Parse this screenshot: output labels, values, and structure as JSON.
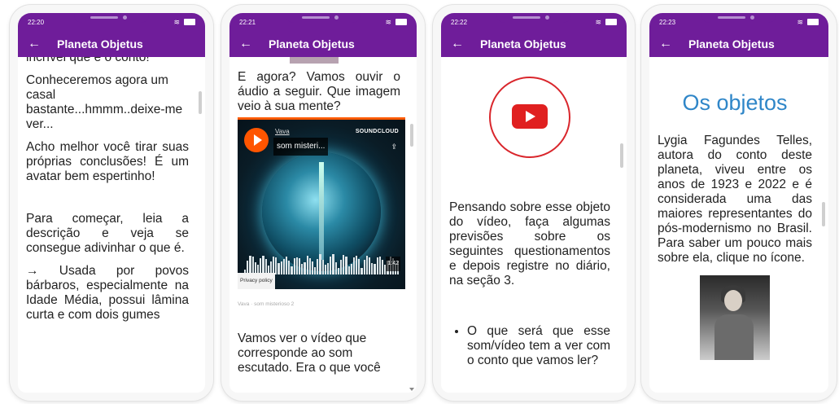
{
  "colors": {
    "appbar": "#6f1d9a",
    "youtube": "#e02020",
    "title_blue": "#2f86c8"
  },
  "icons": {
    "back": "←",
    "wifi": "wifi-icon",
    "battery": "battery-icon"
  },
  "app": {
    "title": "Planeta Objetus",
    "back_glyph": "←",
    "wifi_glyph": "≋"
  },
  "phones": [
    {
      "time": "22:20",
      "paragraphs": [
        "incrível que é o conto!",
        "Conheceremos agora um casal bastante...hmmm..deixe-me ver...",
        "Acho melhor você tirar suas próprias conclusões! É um avatar bem espertinho!",
        "Para começar, leia a descrição e veja se consegue adivinhar o que é.",
        "→ Usada por povos bárbaros, especialmente na Idade Média, possui lâmina curta e com dois gumes"
      ]
    },
    {
      "time": "22:21",
      "intro": "E agora? Vamos ouvir o áudio a seguir. Que imagem veio à sua mente?",
      "player": {
        "user": "Vava",
        "track": "som misteri...",
        "brand": "SOUNDCLOUD",
        "duration": "1:42",
        "privacy": "Privacy policy",
        "caption": "Vava · som misterioso 2"
      },
      "outro": "Vamos ver o vídeo que corresponde ao som escutado. Era o que você"
    },
    {
      "time": "22:22",
      "paragraph": "Pensando sobre esse objeto do vídeo, faça algumas previsões sobre os seguintes questionamentos e depois registre no diário, na seção 3.",
      "bullets": [
        "O que será que esse som/vídeo tem a ver com o conto que vamos ler?"
      ]
    },
    {
      "time": "22:23",
      "heading": "Os objetos",
      "paragraph": "Lygia Fagundes Telles, autora do conto deste planeta, viveu entre os anos de 1923 e 2022 e é considerada uma das maiores representantes do pós-modernismo no Brasil. Para saber um pouco mais sobre ela, clique no ícone."
    }
  ]
}
